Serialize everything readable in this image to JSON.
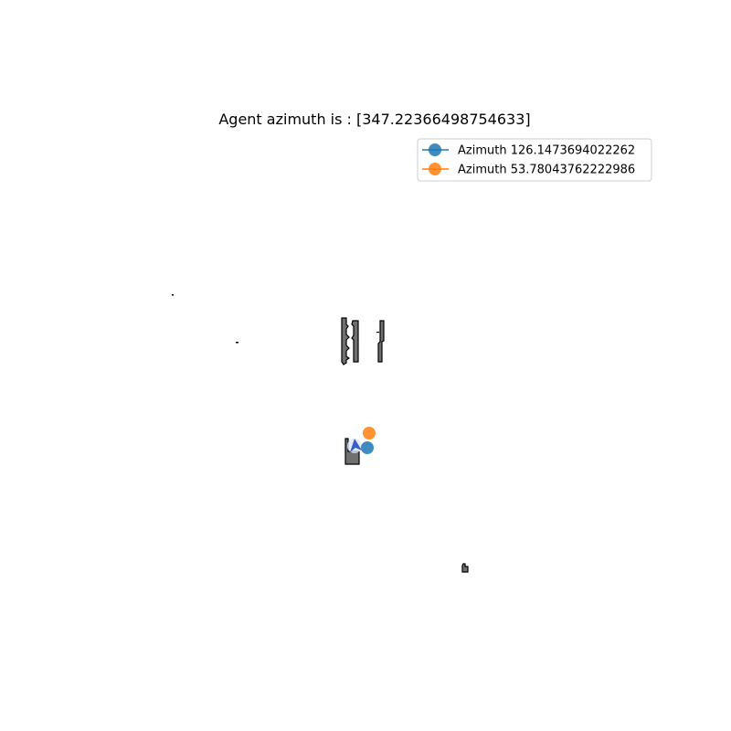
{
  "title": "Agent azimuth is : [347.22366498754633]",
  "chart_data": {
    "type": "scatter",
    "title": "Agent azimuth is : [347.22366498754633]",
    "xlabel": "",
    "ylabel": "",
    "grid": false,
    "axes_visible": false,
    "legend_position": "upper-right",
    "series": [
      {
        "name": "Azimuth 126.1473694022262",
        "color": "#1f77b4",
        "marker": "circle"
      },
      {
        "name": "Azimuth 53.78043762222986",
        "color": "#ff7f0e",
        "marker": "circle"
      }
    ]
  },
  "map": {
    "obstacle_fill": "#707070",
    "obstacle_stroke": "#000000",
    "agent_color": "#3a5fcd"
  }
}
